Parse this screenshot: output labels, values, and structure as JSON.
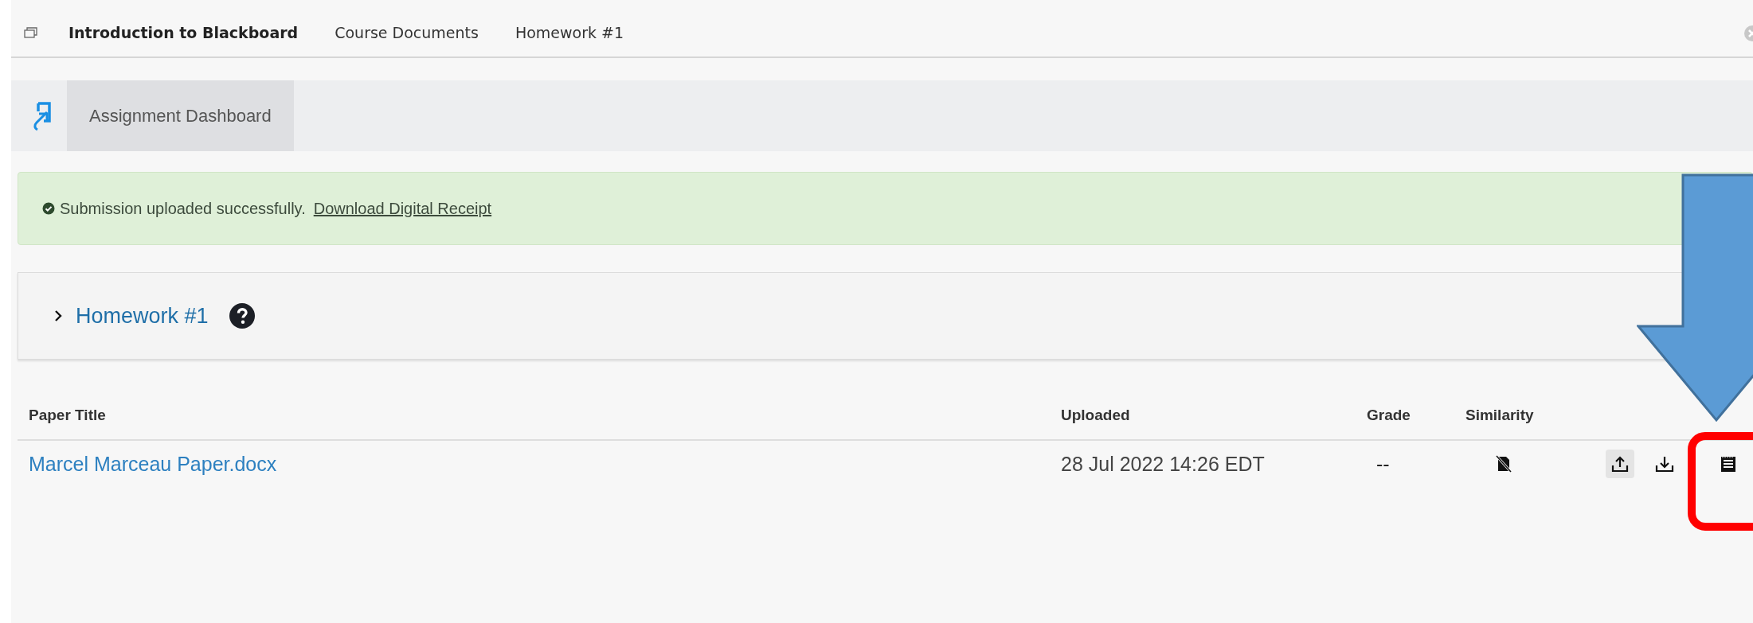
{
  "breadcrumbs": [
    {
      "label": "Introduction to Blackboard",
      "selected": true
    },
    {
      "label": "Course Documents",
      "selected": false
    },
    {
      "label": "Homework #1",
      "selected": false
    }
  ],
  "nav": {
    "title": "Assignment Dashboard"
  },
  "alert": {
    "message": "Submission uploaded successfully.",
    "link": "Download Digital Receipt"
  },
  "assignment": {
    "title": "Homework #1",
    "expanded": false
  },
  "table": {
    "columns": [
      "Paper Title",
      "Uploaded",
      "Grade",
      "Similarity"
    ],
    "rows": [
      {
        "title": "Marcel Marceau Paper.docx",
        "uploaded": "28 Jul 2022 14:26 EDT",
        "grade": "--"
      }
    ]
  }
}
